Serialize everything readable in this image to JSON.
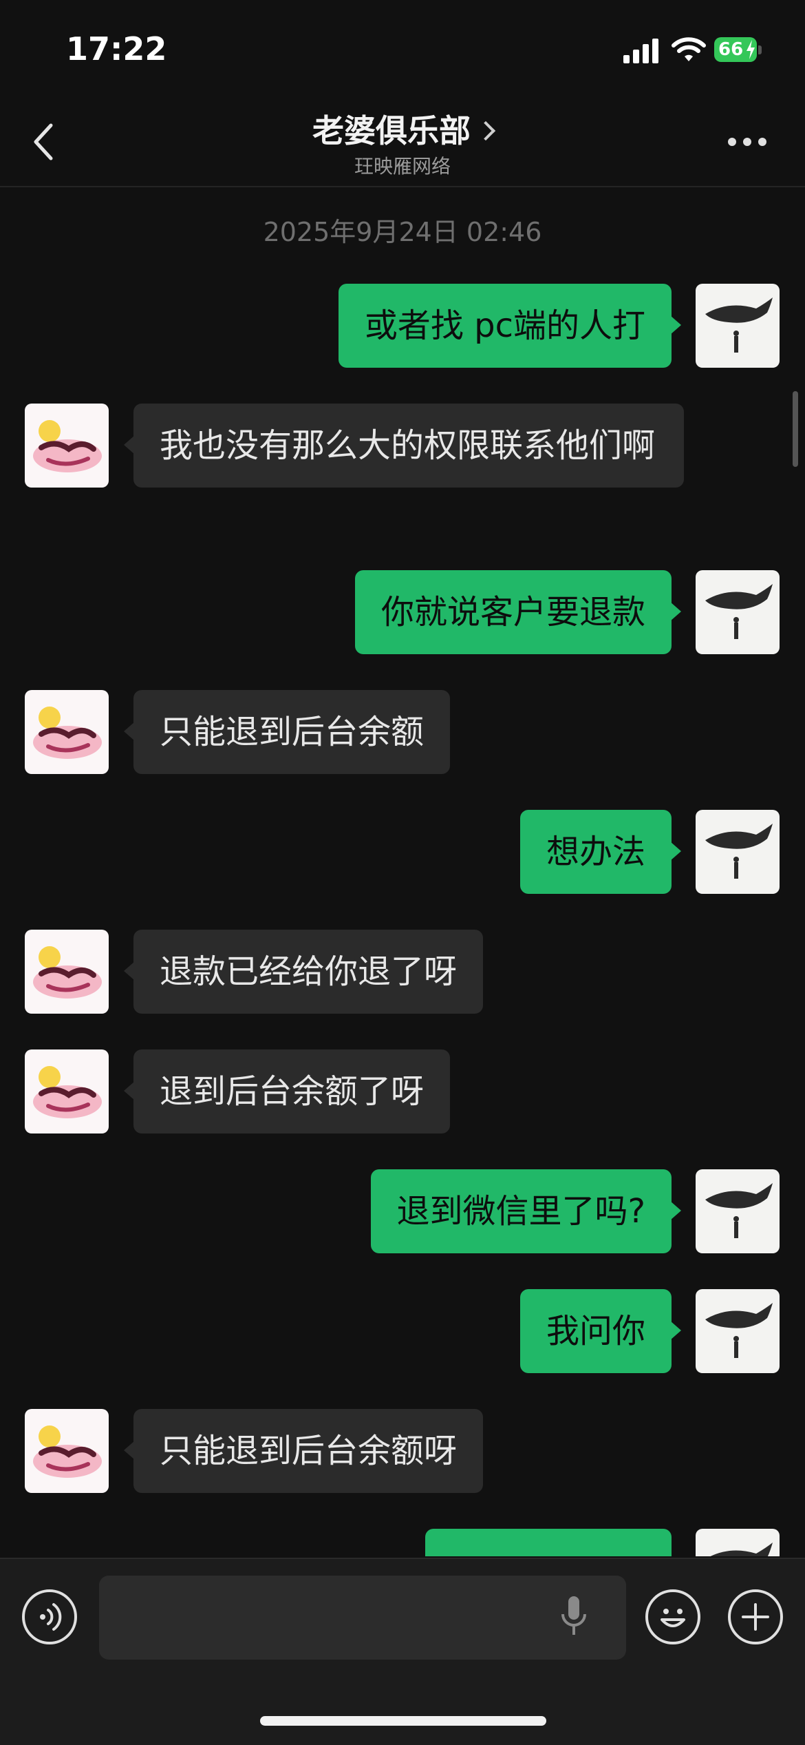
{
  "status_bar": {
    "time": "17:22",
    "battery": "66"
  },
  "header": {
    "title": "老婆俱乐部",
    "subtitle": "玨映雁网络"
  },
  "chat": {
    "timestamp": "2025年9月24日 02:46",
    "messages": [
      {
        "side": "out",
        "text": "或者找 pc端的人打"
      },
      {
        "side": "in",
        "text": "我也没有那么大的权限联系他们啊"
      },
      {
        "side": "out",
        "text": "你就说客户要退款"
      },
      {
        "side": "in",
        "text": "只能退到后台余额"
      },
      {
        "side": "out",
        "text": "想办法"
      },
      {
        "side": "in",
        "text": "退款已经给你退了呀"
      },
      {
        "side": "in",
        "text": "退到后台余额了呀"
      },
      {
        "side": "out",
        "text": "退到微信里了吗?"
      },
      {
        "side": "out",
        "text": "我问你"
      },
      {
        "side": "in",
        "text": "只能退到后台余额呀"
      }
    ]
  },
  "input_bar": {
    "placeholder": ""
  },
  "colors": {
    "outgoing_bubble": "#21b868",
    "incoming_bubble": "#2b2b2b",
    "background": "#111111"
  }
}
